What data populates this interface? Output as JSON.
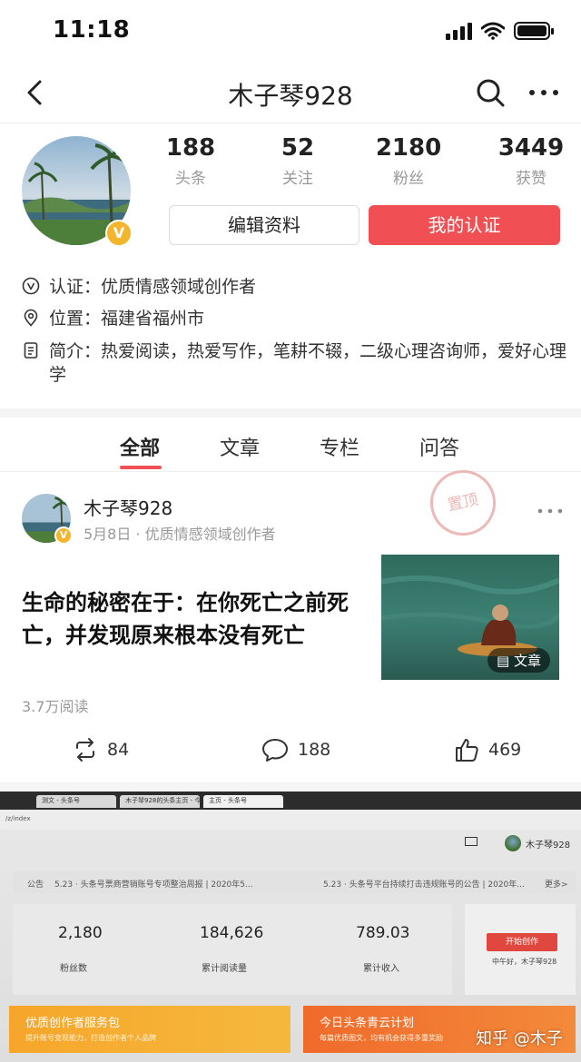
{
  "status_bar": {
    "time": "11:18"
  },
  "nav": {
    "title": "木子琴928"
  },
  "profile": {
    "stats": [
      {
        "value": "188",
        "label": "头条"
      },
      {
        "value": "52",
        "label": "关注"
      },
      {
        "value": "2180",
        "label": "粉丝"
      },
      {
        "value": "3449",
        "label": "获赞"
      }
    ],
    "edit_label": "编辑资料",
    "cert_label": "我的认证",
    "badge": "V",
    "info": {
      "certification": "认证：优质情感领域创作者",
      "location": "位置：福建省福州市",
      "bio": "简介：热爱阅读，热爱写作，笔耕不辍，二级心理咨询师，爱好心理学"
    }
  },
  "tabs": [
    "全部",
    "文章",
    "专栏",
    "问答"
  ],
  "post": {
    "author": "木子琴928",
    "meta": "5月8日 · 优质情感领域创作者",
    "stamp": "置顶",
    "title": "生命的秘密在于：在你死亡之前死亡，并发现原来根本没有死亡",
    "thumb_badge": "文章",
    "reads": "3.7万阅读",
    "reposts": "84",
    "comments": "188",
    "likes": "469"
  },
  "embedded_photo": {
    "browser_tabs": [
      "测文 - 头条号",
      "木子琴928的头条主页 - 今日",
      "主页 - 头条号"
    ],
    "address": "/z/index",
    "header_user": "木子琴928",
    "notice_label": "公告",
    "notice_1": "5.23 · 头条号票商营销账号专项整治周报 | 2020年5...",
    "notice_2": "5.23 · 头条号平台持续打击违规账号的公告 | 2020年...",
    "notice_more": "更多>",
    "dash": [
      {
        "value": "2,180",
        "label": "粉丝数"
      },
      {
        "value": "184,626",
        "label": "累计阅读量"
      },
      {
        "value": "789.03",
        "label": "累计收入"
      }
    ],
    "start_btn": "开始创作",
    "greeting": "中午好，木子琴928",
    "banner_left_title": "优质创作者服务包",
    "banner_left_sub": "提升账号变现能力，打造创作者个人品牌",
    "banner_right_title": "今日头条青云计划",
    "banner_right_sub": "每篇优质图文，均有机会获得多重奖励"
  },
  "watermark": "知乎 @木子",
  "colors": {
    "accent": "#f04f53",
    "badge": "#f3b52b"
  }
}
